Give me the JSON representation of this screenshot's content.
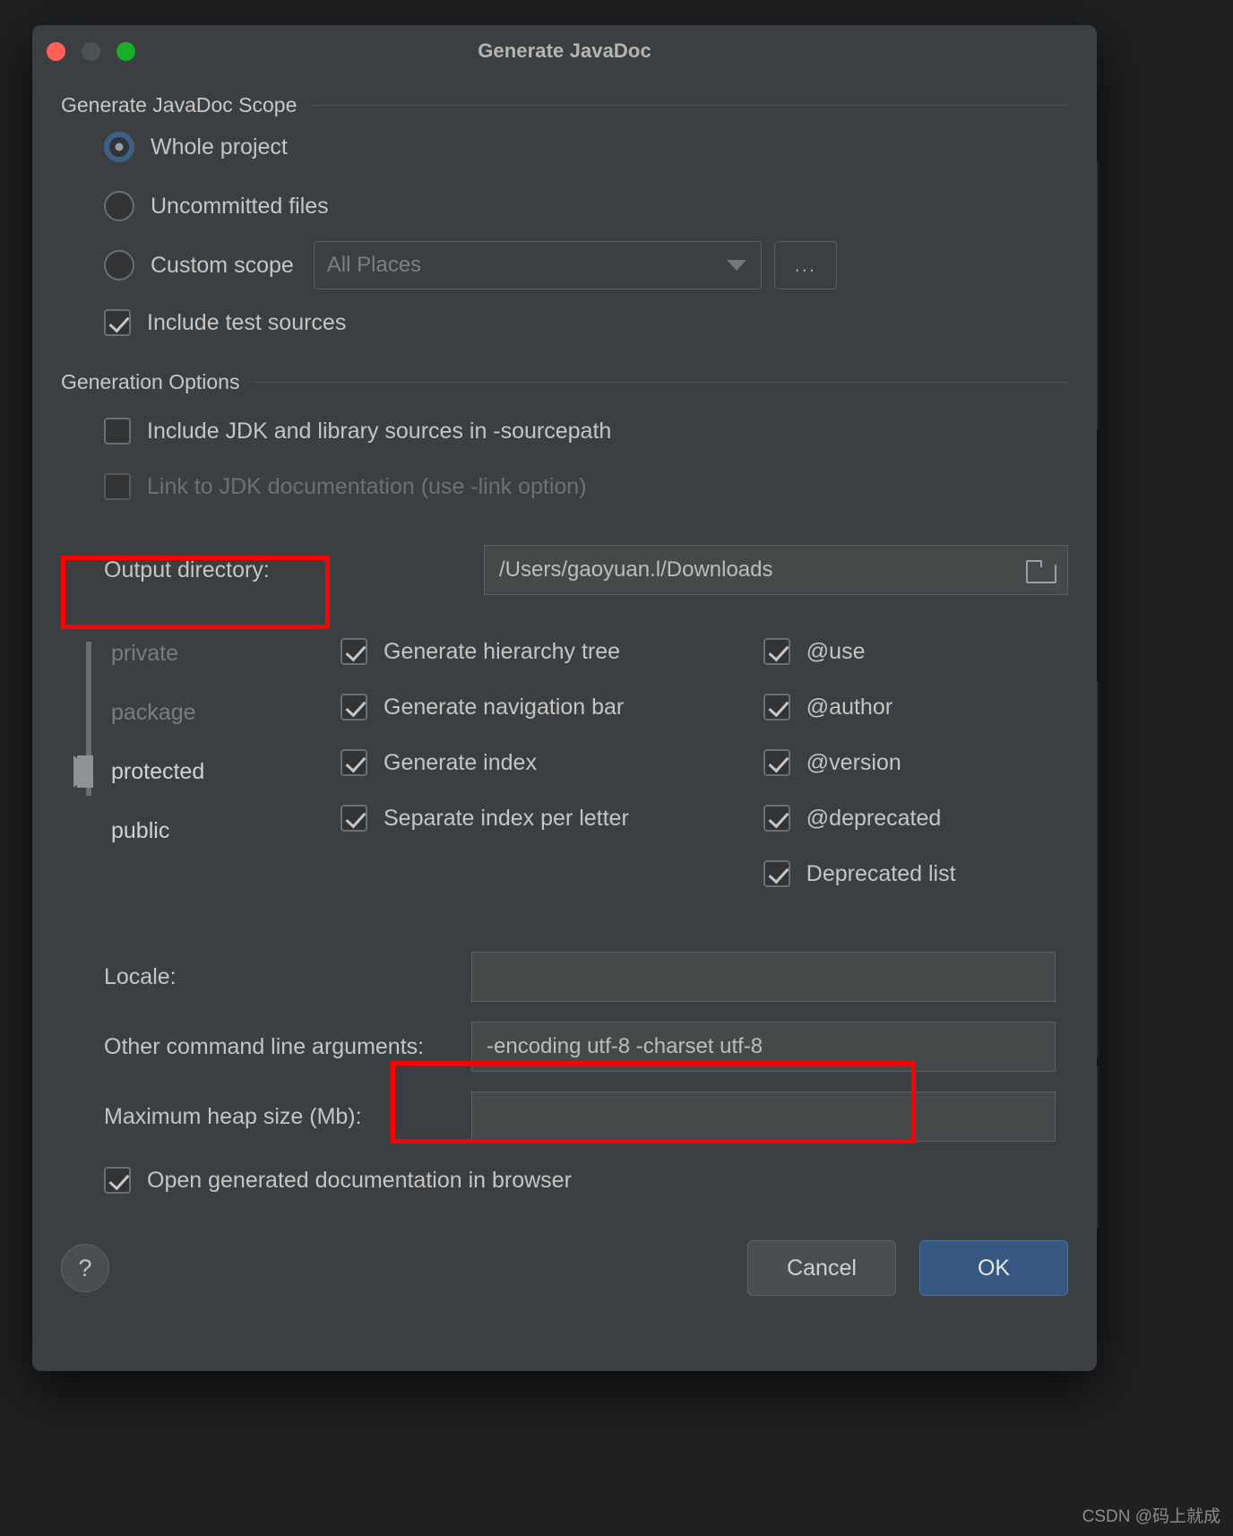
{
  "window": {
    "title": "Generate JavaDoc",
    "traffic_lights": [
      "close-button",
      "minimize-button",
      "zoom-button"
    ]
  },
  "scope_section": {
    "label": "Generate JavaDoc Scope",
    "radios": [
      {
        "label": "Whole project",
        "checked": true
      },
      {
        "label": "Uncommitted files",
        "checked": false
      },
      {
        "label": "Custom scope",
        "checked": false
      }
    ],
    "custom_scope_combo": {
      "value": "All Places",
      "placeholder": "All Places"
    },
    "browse_button": "...",
    "include_test_sources": {
      "label": "Include test sources",
      "checked": true
    }
  },
  "generation_section": {
    "label": "Generation Options",
    "include_jdk": {
      "label": "Include JDK and library sources in -sourcepath",
      "checked": false,
      "disabled": false
    },
    "link_jdk": {
      "label": "Link to JDK documentation (use -link option)",
      "checked": false,
      "disabled": true
    },
    "output_directory": {
      "label": "Output directory:",
      "value": "/Users/gaoyuan.l/Downloads"
    }
  },
  "visibility_slider": {
    "levels": [
      "private",
      "package",
      "protected",
      "public"
    ],
    "selected": "protected"
  },
  "middle_options": [
    {
      "label": "Generate hierarchy tree",
      "checked": true
    },
    {
      "label": "Generate navigation bar",
      "checked": true
    },
    {
      "label": "Generate index",
      "checked": true
    },
    {
      "label": "Separate index per letter",
      "checked": true
    }
  ],
  "right_options": [
    {
      "label": "@use",
      "checked": true
    },
    {
      "label": "@author",
      "checked": true
    },
    {
      "label": "@version",
      "checked": true
    },
    {
      "label": "@deprecated",
      "checked": true
    },
    {
      "label": "Deprecated list",
      "checked": true
    }
  ],
  "bottom_fields": [
    {
      "label": "Locale:",
      "value": ""
    },
    {
      "label": "Other command line arguments:",
      "value": "-encoding utf-8 -charset utf-8"
    },
    {
      "label": "Maximum heap size (Mb):",
      "value": ""
    }
  ],
  "open_in_browser": {
    "label": "Open generated documentation in browser",
    "checked": true
  },
  "footer": {
    "help_label": "?",
    "cancel_label": "Cancel",
    "ok_label": "OK"
  },
  "annotation_color": "#ff0000",
  "watermark": "CSDN @码上就成"
}
